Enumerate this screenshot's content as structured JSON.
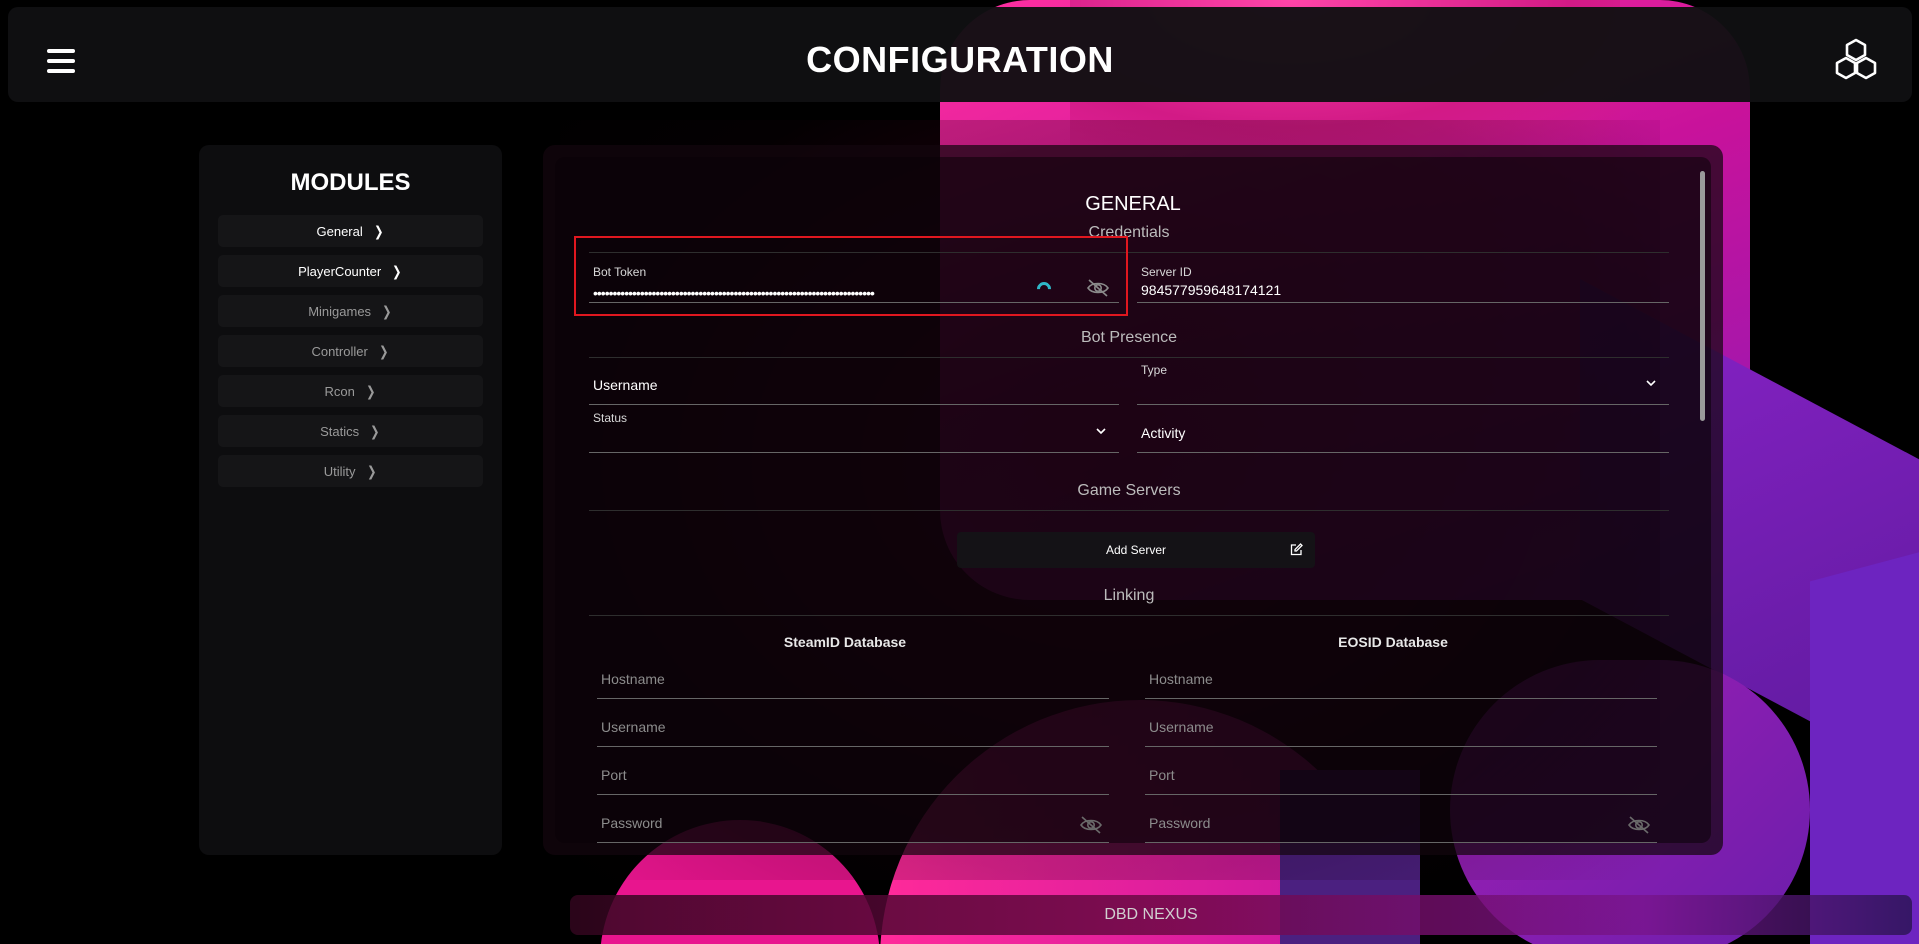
{
  "header": {
    "title": "CONFIGURATION",
    "menu_icon": "hamburger-menu-icon",
    "logo_icon": "hexagon-logo-icon"
  },
  "modules": {
    "title": "MODULES",
    "items": [
      {
        "label": "General"
      },
      {
        "label": "PlayerCounter"
      },
      {
        "label": "Minigames"
      },
      {
        "label": "Controller"
      },
      {
        "label": "Rcon"
      },
      {
        "label": "Statics"
      },
      {
        "label": "Utility"
      }
    ]
  },
  "panel": {
    "title": "GENERAL",
    "credentials": {
      "section_title": "Credentials",
      "bot_token_label": "Bot Token",
      "bot_token_value": "••••••••••••••••••••••••••••••••••••••••••••••••••••••••••••••••••••••••",
      "server_id_label": "Server ID",
      "server_id_value": "984577959648174121"
    },
    "presence": {
      "section_title": "Bot Presence",
      "username_label": "Username",
      "type_label": "Type",
      "status_label": "Status",
      "activity_label": "Activity"
    },
    "game_servers": {
      "section_title": "Game Servers",
      "add_button": "Add Server"
    },
    "linking": {
      "section_title": "Linking",
      "steam": {
        "title": "SteamID Database",
        "hostname": "Hostname",
        "username": "Username",
        "port": "Port",
        "password": "Password"
      },
      "eos": {
        "title": "EOSID Database",
        "hostname": "Hostname",
        "username": "Username",
        "port": "Port",
        "password": "Password"
      }
    }
  },
  "footer": {
    "text": "DBD NEXUS"
  },
  "colors": {
    "accent_pink": "#ff2fa0",
    "accent_purple": "#8a22c8",
    "highlight_red": "#e0171f",
    "spinner_teal": "#2fb7c7"
  }
}
